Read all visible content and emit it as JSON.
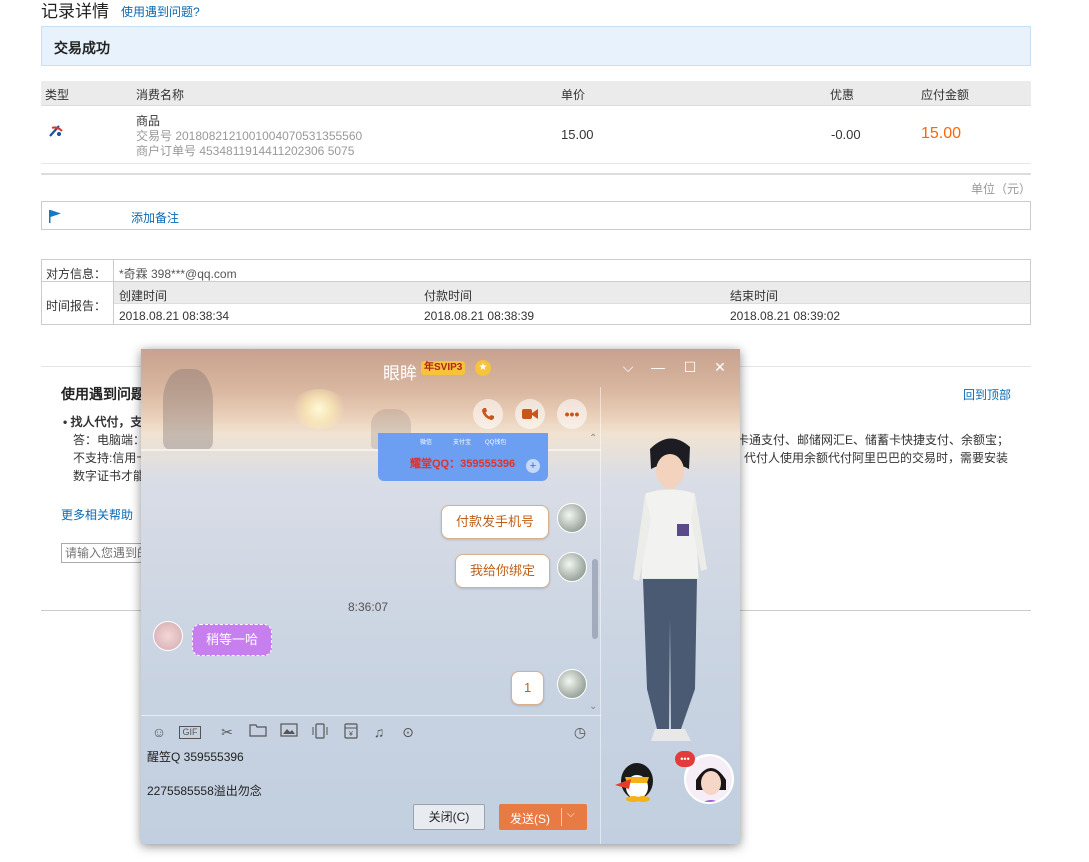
{
  "header": {
    "title": "记录详情",
    "help_link": "使用遇到问题?"
  },
  "status": {
    "text": "交易成功"
  },
  "table": {
    "columns": [
      "类型",
      "消费名称",
      "单价",
      "优惠",
      "应付金额"
    ],
    "row": {
      "name": "商品",
      "trade_no": "交易号 2018082121001004070531355560",
      "merchant_no": "商户订单号 4534811914411202306 5075",
      "price": "15.00",
      "discount": "-0.00",
      "amount": "15.00"
    },
    "unit": "单位（元）"
  },
  "note": {
    "add_note": "添加备注"
  },
  "info": {
    "counterpart_label": "对方信息：",
    "counterpart_value": "*奇霖 398***@qq.com",
    "time_label": "时间报告：",
    "created_label": "创建时间",
    "paid_label": "付款时间",
    "ended_label": "结束时间",
    "created": "2018.08.21 08:38:34",
    "paid": "2018.08.21 08:38:39",
    "ended": "2018.08.21 08:39:02"
  },
  "help": {
    "title": "使用遇到问题",
    "back_to_top": "回到顶部",
    "item_title": "• 找人代付，支",
    "line1_left": "答：电脑端：",
    "line1_right": "卡通支付、邮储网汇E、储蓄卡快捷支付、余额宝；",
    "line2_left": "不支持:信用卡",
    "line2_right": "代付人使用余额代付阿里巴巴的交易时，需要安装",
    "line3_left": "数字证书才能",
    "more": "更多相关帮助",
    "search_placeholder": "请输入您遇到的"
  },
  "chat": {
    "name": "眼眸",
    "vip": "年SVIP3",
    "card_labels": [
      "微信",
      "支付宝",
      "QQ钱包"
    ],
    "card_text": "耀堂QQ：359555396",
    "msg1": "付款发手机号",
    "msg2": "我给你绑定",
    "time": "8:36:07",
    "msg3": "稍等一哈",
    "msg4": "1",
    "input_line1": "醒笠Q 359555396",
    "input_line2": "2275585558溢出勿念",
    "close_btn": "关闭(C)",
    "send_btn": "发送(S)"
  },
  "colors": {
    "accent_orange": "#e87b43",
    "price_orange": "#ff6600",
    "link_blue": "#0a6ab3",
    "status_bg": "#e8f2fd"
  }
}
